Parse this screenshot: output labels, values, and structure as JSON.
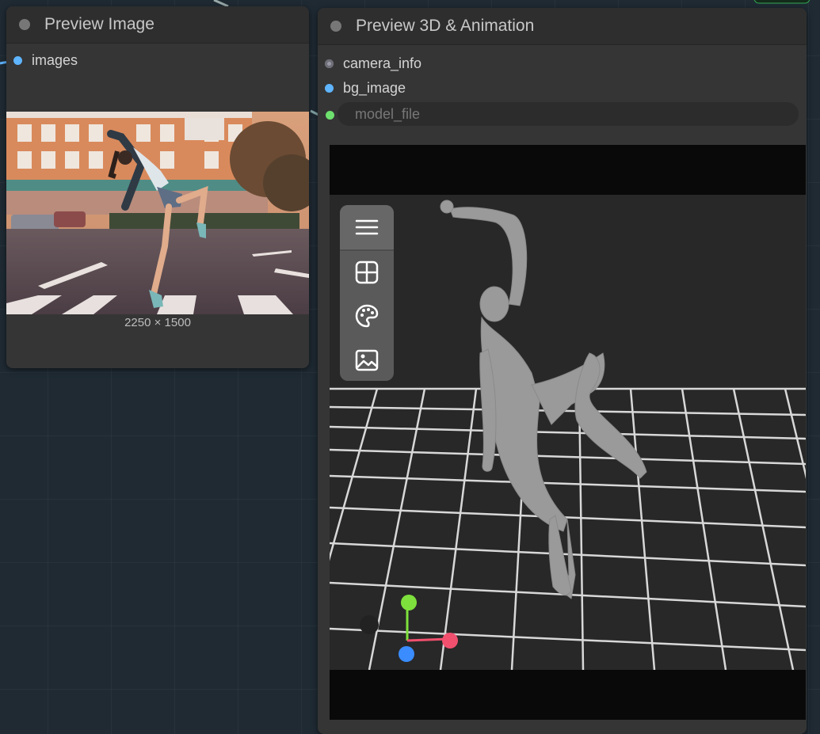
{
  "canvas": {
    "background": "#1f2a33"
  },
  "preview_image_node": {
    "title": "Preview Image",
    "input_slot": {
      "label": "images",
      "color": "#5fb5ff"
    },
    "image_dimensions": "2250 × 1500"
  },
  "preview_3d_node": {
    "title": "Preview 3D & Animation",
    "input_slots": [
      {
        "label": "camera_info",
        "color": "#9a9aa6"
      },
      {
        "label": "bg_image",
        "color": "#5fb5ff"
      }
    ],
    "model_file_widget": {
      "placeholder": "model_file",
      "slot_color": "#6ee06e"
    },
    "toolbar_icons": [
      "menu-icon",
      "grid-icon",
      "palette-icon",
      "image-icon"
    ],
    "axis_colors": {
      "x": "#f0506e",
      "y": "#7ee03c",
      "z": "#3a8cff"
    }
  }
}
